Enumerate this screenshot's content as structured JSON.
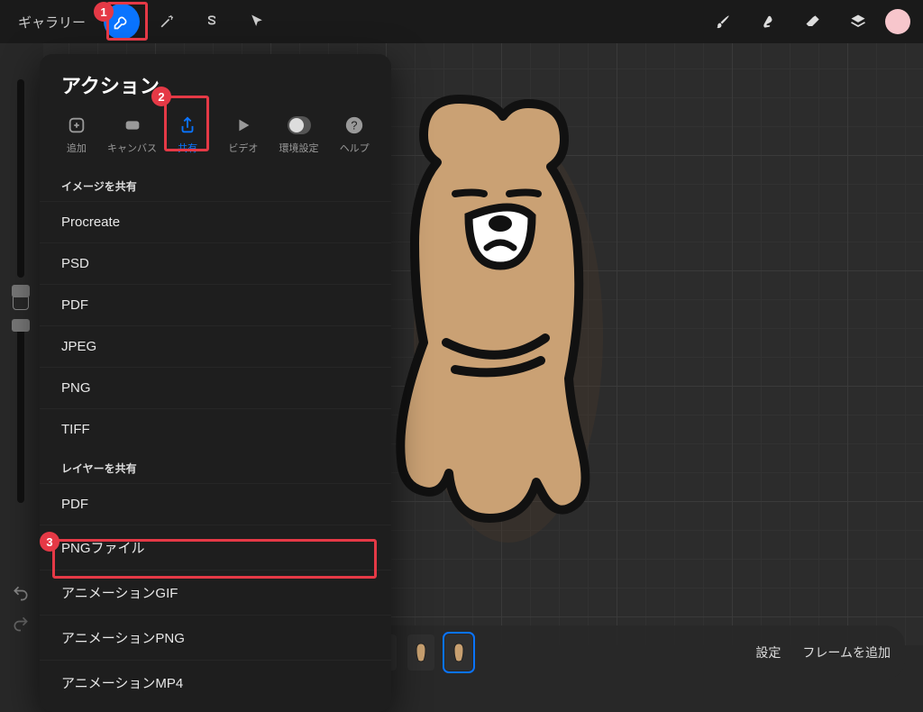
{
  "topbar": {
    "gallery": "ギャラリー"
  },
  "panel": {
    "title": "アクション",
    "tabs": {
      "add": "追加",
      "canvas": "キャンバス",
      "share": "共有",
      "video": "ビデオ",
      "prefs": "環境設定",
      "help": "ヘルプ"
    },
    "section_image": "イメージを共有",
    "section_layer": "レイヤーを共有",
    "image_opts": [
      "Procreate",
      "PSD",
      "PDF",
      "JPEG",
      "PNG",
      "TIFF"
    ],
    "layer_opts": [
      "PDF",
      "PNGファイル",
      "アニメーションGIF",
      "アニメーションPNG",
      "アニメーションMP4"
    ]
  },
  "timeline": {
    "settings": "設定",
    "add_frame": "フレームを追加"
  },
  "annotations": {
    "b1": "1",
    "b2": "2",
    "b3": "3"
  }
}
